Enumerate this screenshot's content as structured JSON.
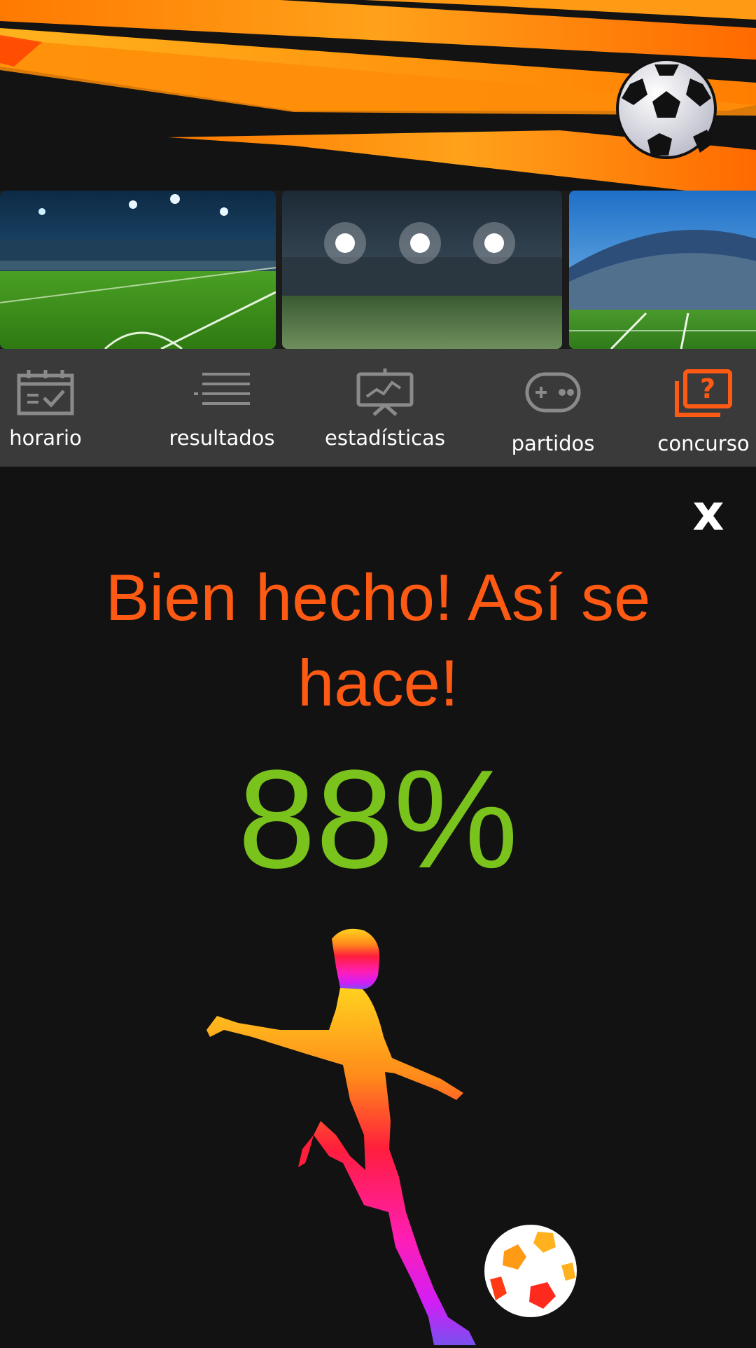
{
  "nav": {
    "items": [
      {
        "label": "horario",
        "icon": "calendar-icon"
      },
      {
        "label": "resultados",
        "icon": "list-icon"
      },
      {
        "label": "estadísticas",
        "icon": "presentation-chart-icon"
      },
      {
        "label": "partidos",
        "icon": "gamepad-icon"
      },
      {
        "label": "concurso",
        "icon": "quiz-icon",
        "active": true
      }
    ]
  },
  "result": {
    "close_label": "x",
    "message": "Bien hecho! Así se hace!",
    "score": "88%"
  },
  "colors": {
    "accent": "#ff5a14",
    "score": "#7ac21c",
    "nav_bg": "#3a3a3a",
    "page_bg": "#121212"
  }
}
